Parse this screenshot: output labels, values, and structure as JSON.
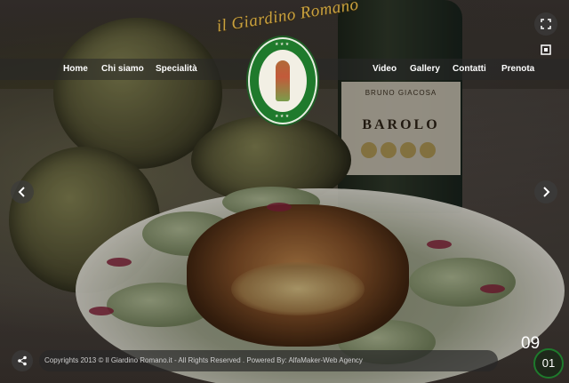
{
  "brand": {
    "name": "il Giardino Romano"
  },
  "nav": {
    "left": [
      "Home",
      "Chi siamo",
      "Specialità"
    ],
    "right": [
      "Video",
      "Gallery",
      "Contatti",
      "Prenota"
    ]
  },
  "background": {
    "bottle_label_small": "BRUNO GIACOSA",
    "bottle_label_big": "BAROLO"
  },
  "slider": {
    "current": "01",
    "total": "09"
  },
  "footer": {
    "copyright": "Copyrights 2013 © Il Giardino Romano.it - All Rights Reserved . Powered By: AlfaMaker-Web Agency"
  },
  "icons": {
    "prev": "chevron-left-icon",
    "next": "chevron-right-icon",
    "fullscreen": "fullscreen-icon",
    "grid": "grid-icon",
    "share": "share-icon"
  },
  "colors": {
    "logo_gold": "#c9a13f",
    "emblem_green": "#1f7a2c",
    "navbar_bg": "rgba(40,40,40,0.55)"
  }
}
